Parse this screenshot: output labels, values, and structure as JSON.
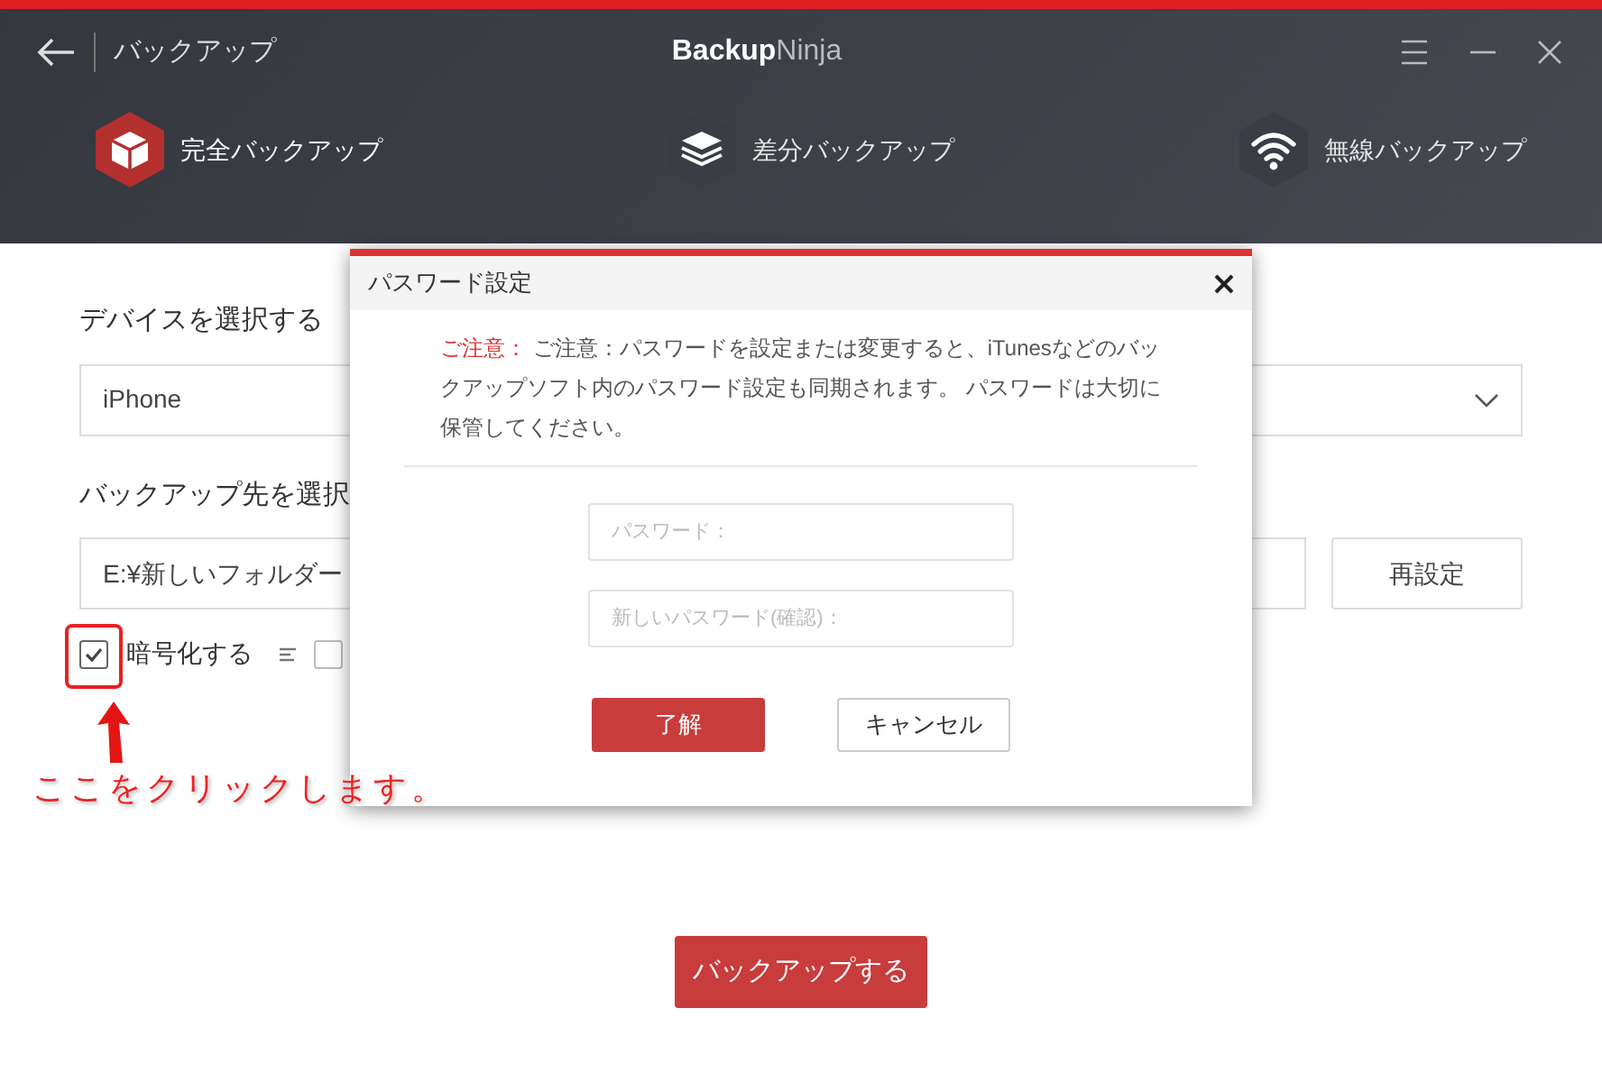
{
  "header": {
    "title": "バックアップ",
    "brand_bold": "Backup",
    "brand_light": "Ninja"
  },
  "modes": [
    {
      "label": "完全バックアップ",
      "kind": "full",
      "selected": true
    },
    {
      "label": "差分バックアップ",
      "kind": "diff",
      "selected": false
    },
    {
      "label": "無線バックアップ",
      "kind": "wireless",
      "selected": false
    }
  ],
  "device": {
    "label": "デバイスを選択する",
    "value": "iPhone"
  },
  "destination": {
    "label": "バックアップ先を選択",
    "value": "E:¥新しいフォルダー",
    "reset_button": "再設定"
  },
  "options": [
    {
      "label": "暗号化する",
      "checked": true
    },
    {
      "checked": false
    }
  ],
  "backup_button": "バックアップする",
  "dialog": {
    "title": "パスワード設定",
    "notice_label": "ご注意：",
    "notice": "ご注意：パスワードを設定または変更すると、iTunesなどのバックアップソフト内のパスワード設定も同期されます。 パスワードは大切に保管してください。",
    "password_placeholder": "パスワード：",
    "confirm_placeholder": "新しいパスワード(確認)：",
    "ok": "了解",
    "cancel": "キャンセル"
  },
  "annotation": "ここをクリックします。"
}
